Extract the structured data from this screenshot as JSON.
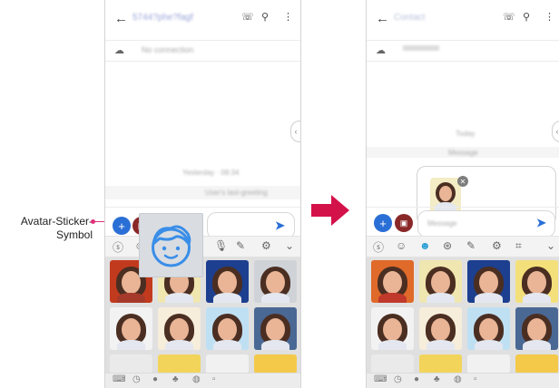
{
  "callout": {
    "label": "Avatar-Sticker-\nSymbol"
  },
  "icons": {
    "back": "←",
    "call": "☏",
    "search": "⚲",
    "more": "⋮",
    "cloud": "☁",
    "plus": "+",
    "send": "➤",
    "close": "✕",
    "collapse_handle": "‹",
    "chevron_down": "⌄"
  },
  "left_phone": {
    "contact_title": "5744?phe?fagf",
    "connection_status": "No connection",
    "system_line_1": "Yesterday · 08:34",
    "system_line_2": "User's last-greeting",
    "toolbar_icons": [
      "sticker-icon",
      "emoji-icon",
      "mic-icon",
      "handwriting-icon",
      "settings-icon",
      "chevron-down-icon"
    ],
    "tray_icons": [
      "keyboard-icon",
      "recent-icon",
      "avatar-icon",
      "stickers-icon",
      "gif-icon",
      "more-icon"
    ]
  },
  "right_phone": {
    "contact_title": "Contact",
    "connection_status": "",
    "system_line_1": "Today",
    "system_line_2": "Message",
    "message_placeholder": "Message",
    "toolbar_icons": [
      "sticker-icon",
      "emoji-icon",
      "avatar-sticker-icon",
      "gif-search-icon",
      "handwriting-icon",
      "settings-icon",
      "resize-icon",
      "chevron-down-icon"
    ],
    "tray_icons": [
      "keyboard-icon",
      "recent-icon",
      "avatar-icon",
      "stickers-icon",
      "gif-icon",
      "more-icon"
    ]
  },
  "colors": {
    "accent": "#2a6fd6",
    "callout_line": "#e0307a",
    "arrow": "#d4124a",
    "active_tab": "#2a9fd6"
  }
}
